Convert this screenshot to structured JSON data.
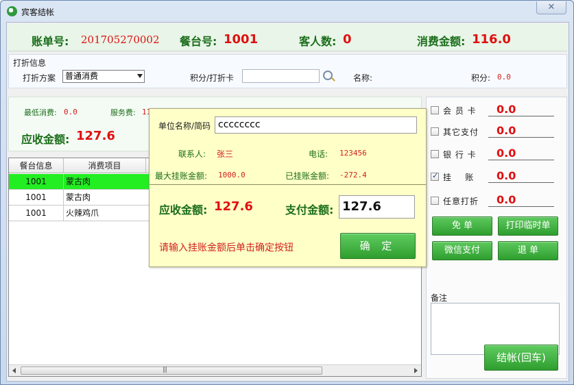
{
  "window": {
    "title": "宾客结帐",
    "close_glyph": "✕"
  },
  "summary": {
    "bill_no_label": "账单号:",
    "bill_no": "201705270002",
    "table_no_label": "餐台号:",
    "table_no": "1001",
    "guests_label": "客人数:",
    "guests": "0",
    "amount_label": "消费金额:",
    "amount": "116.0"
  },
  "discount": {
    "section_title": "打折信息",
    "scheme_label": "打折方案",
    "scheme_value": "普通消费",
    "card_label": "积分/打折卡",
    "card_value": "",
    "name_label": "名称:",
    "name_value": "",
    "points_label": "积分:",
    "points_value": "0.0"
  },
  "info": {
    "min_label": "最低消费:",
    "min_value": "0.0",
    "service_label": "服务费:",
    "service_value": "11",
    "due_label": "应收金额:",
    "due_value": "127.6"
  },
  "table": {
    "headers": [
      "餐台信息",
      "消费项目"
    ],
    "rows": [
      {
        "table": "1001",
        "item": "蒙古肉"
      },
      {
        "table": "1001",
        "item": "蒙古肉"
      },
      {
        "table": "1001",
        "item": "火辣鸡爪"
      }
    ],
    "scroll_grip": "|||"
  },
  "payments": [
    {
      "label": "会 员 卡",
      "amount": "0.0",
      "checked": false
    },
    {
      "label": "其它支付",
      "amount": "0.0",
      "checked": false
    },
    {
      "label": "银 行 卡",
      "amount": "0.0",
      "checked": false
    },
    {
      "label": "挂    账",
      "amount": "0.0",
      "checked": true
    },
    {
      "label": "任意打折",
      "amount": "0.0",
      "checked": false
    }
  ],
  "buttons": {
    "free": "免 单",
    "print_temp": "打印临时单",
    "wechat": "微信支付",
    "refund": "退 单",
    "checkout": "结帐(回车)"
  },
  "remark_label": "备注",
  "popup": {
    "company_label": "单位名称/简码",
    "company_value": "cccccccc",
    "contact_label": "联系人:",
    "contact_value": "张三",
    "phone_label": "电话:",
    "phone_value": "123456",
    "max_label": "最大挂账金额:",
    "max_value": "1000.0",
    "used_label": "已挂账金额:",
    "used_value": "-272.4",
    "due_label": "应收金额:",
    "due_value": "127.6",
    "pay_label": "支付金额:",
    "pay_value": "127.6",
    "hint": "请输入挂账金额后单击确定按钮",
    "confirm": "确 定"
  }
}
